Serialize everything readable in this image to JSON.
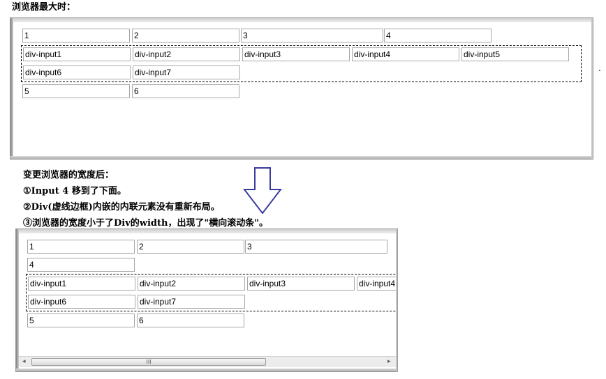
{
  "top_caption": "浏览器最大时：",
  "top_window": {
    "row1": [
      "1",
      "2",
      "3",
      "4"
    ],
    "div_row1": [
      "div-input1",
      "div-input2",
      "div-input3",
      "div-input4",
      "div-input5"
    ],
    "div_row2": [
      "div-input6",
      "div-input7"
    ],
    "row_after": [
      "5",
      "6"
    ],
    "stray_mark": "."
  },
  "notes": {
    "heading": "变更浏览器的宽度后：",
    "note1": "①Input 4 移到了下面。",
    "note2": "②Div(虚线边框)内嵌的内联元素没有重新布局。",
    "note3": "③浏览器的宽度小于了Div的width，出现了\"横向滚动条\"。"
  },
  "bottom_window": {
    "row1": [
      "1",
      "2",
      "3"
    ],
    "row2": [
      "4"
    ],
    "div_row1": [
      "div-input1",
      "div-input2",
      "div-input3",
      "div-input4"
    ],
    "div_row2": [
      "div-input6",
      "div-input7"
    ],
    "row_after": [
      "5",
      "6"
    ],
    "scrollbar": {
      "left_arrow": "◂",
      "right_arrow": "▸",
      "grip": "III"
    }
  },
  "colors": {
    "arrow_outline": "#3b3b9e",
    "dashed_border": "#000000",
    "field_border": "#a7a7a7"
  }
}
